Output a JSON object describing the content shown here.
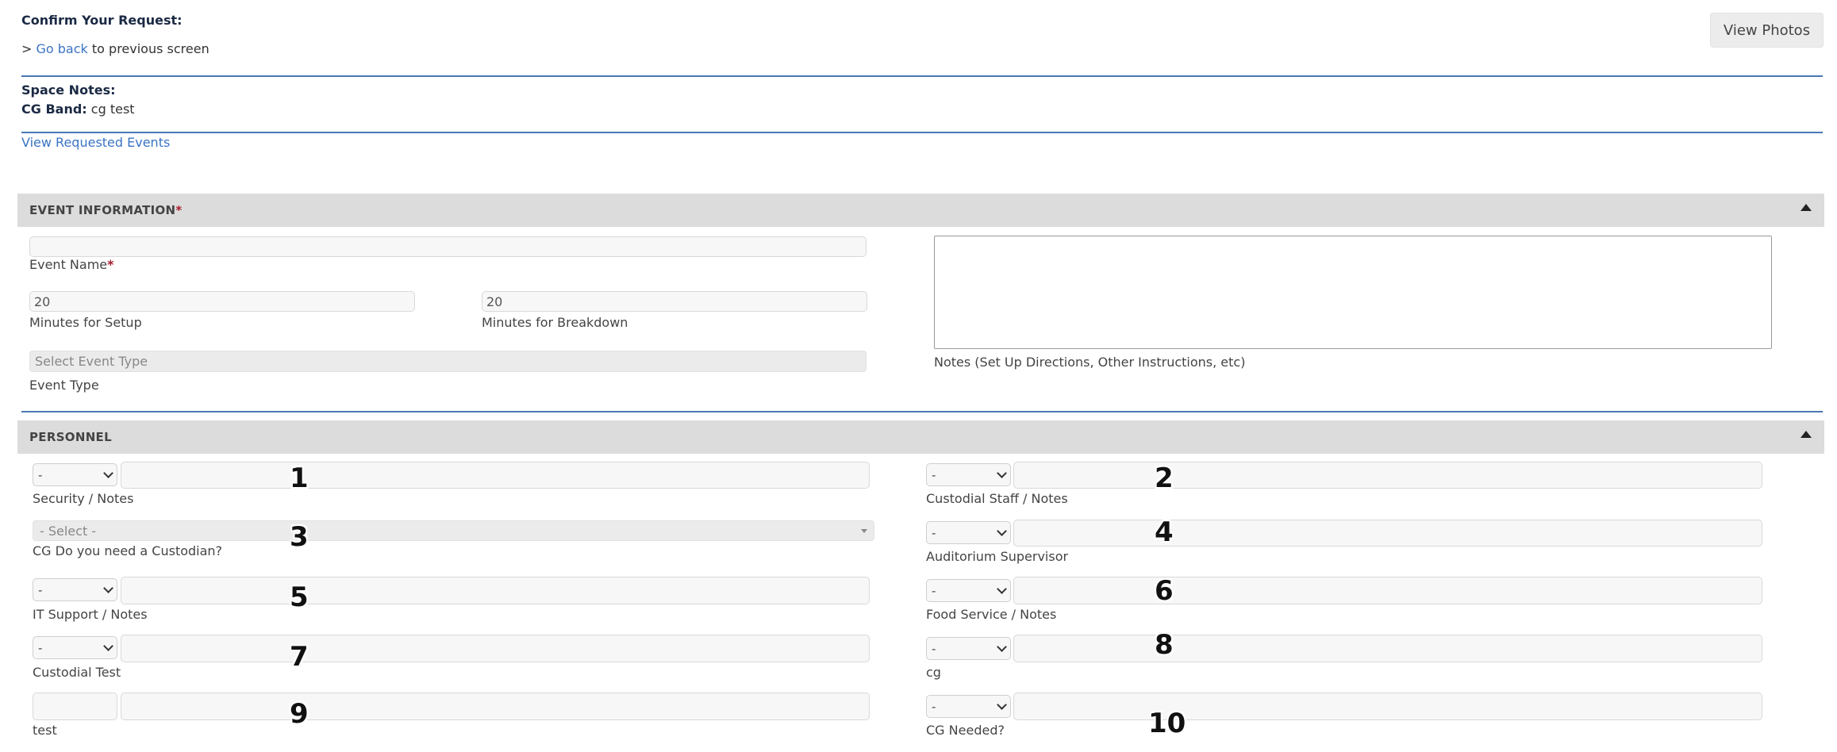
{
  "header": {
    "title": "Confirm Your Request:",
    "back_prefix": ">",
    "back_link": "Go back",
    "back_suffix": "to previous screen",
    "view_photos": "View Photos"
  },
  "space_notes": {
    "label": "Space Notes:",
    "cg_band_label": "CG Band:",
    "cg_band_value": "cg test",
    "view_events_link": "View Requested Events"
  },
  "event_info": {
    "title": "EVENT INFORMATION",
    "required_mark": "*",
    "event_name_label": "Event Name",
    "event_name_value": "",
    "setup_value": "20",
    "setup_label": "Minutes for Setup",
    "breakdown_value": "20",
    "breakdown_label": "Minutes for Breakdown",
    "event_type_placeholder": "Select Event Type",
    "event_type_label": "Event Type",
    "notes_label": "Notes (Set Up Directions, Other Instructions, etc)"
  },
  "personnel": {
    "title": "PERSONNEL",
    "dash": "-",
    "security_label": "Security / Notes",
    "custodial_staff_label": "Custodial Staff / Notes",
    "cg_custodian_placeholder": "- Select -",
    "cg_custodian_label": "CG Do you need a Custodian?",
    "auditorium_label": "Auditorium Supervisor",
    "it_label": "IT Support / Notes",
    "food_label": "Food Service / Notes",
    "custodial_test_label": "Custodial Test",
    "cg_label": "cg",
    "test_label": "test",
    "cg_needed_label": "CG Needed?"
  },
  "markers": [
    "1",
    "2",
    "3",
    "4",
    "5",
    "6",
    "7",
    "8",
    "9",
    "10"
  ]
}
